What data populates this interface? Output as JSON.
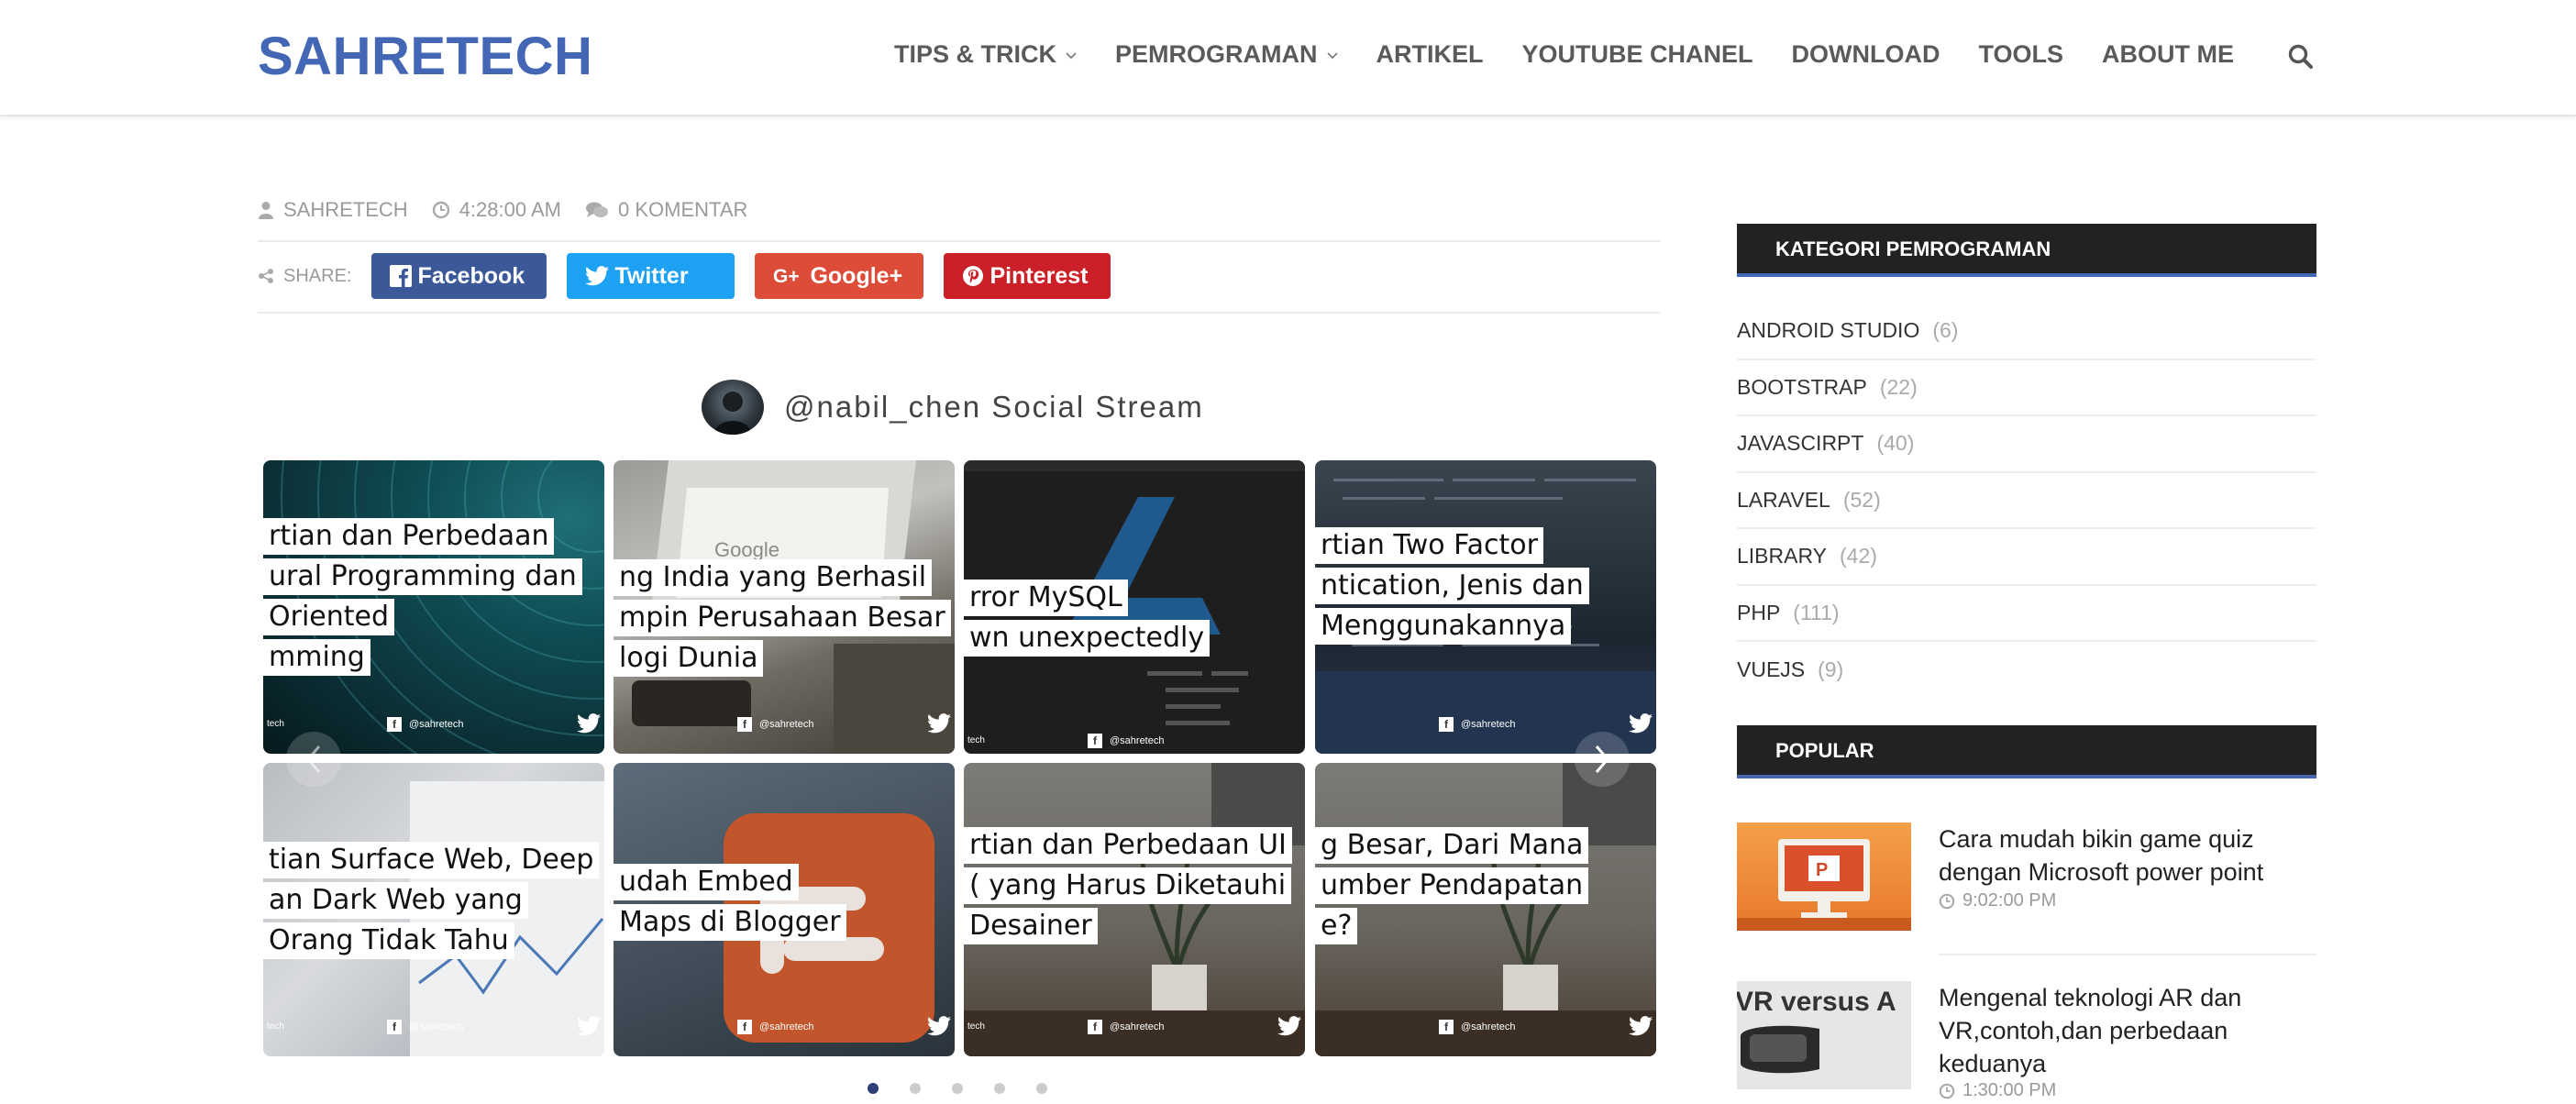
{
  "header": {
    "logo": "SAHRETECH",
    "nav": [
      {
        "label": "TIPS & TRICK",
        "has_dropdown": true
      },
      {
        "label": "PEMROGRAMAN",
        "has_dropdown": true
      },
      {
        "label": "ARTIKEL",
        "has_dropdown": false
      },
      {
        "label": "YOUTUBE CHANEL",
        "has_dropdown": false
      },
      {
        "label": "DOWNLOAD",
        "has_dropdown": false
      },
      {
        "label": "TOOLS",
        "has_dropdown": false
      },
      {
        "label": "ABOUT ME",
        "has_dropdown": false
      }
    ],
    "search_icon": "search-icon"
  },
  "post": {
    "author": "SAHRETECH",
    "time": "4:28:00 AM",
    "comments": "0 KOMENTAR",
    "share_label": "SHARE:",
    "share_buttons": {
      "facebook": "Facebook",
      "twitter": "Twitter",
      "googleplus": "Google+",
      "pinterest": "Pinterest"
    }
  },
  "stream": {
    "title": "@nabil_chen Social Stream",
    "tiles": [
      {
        "lines": [
          "rtian dan Perbedaan",
          "ural Programming dan",
          " Oriented",
          "mming"
        ],
        "footer": "@sahretech"
      },
      {
        "lines": [
          "ng India yang Berhasil",
          "mpin Perusahaan Besar",
          "logi Dunia"
        ],
        "footer": "@sahretech"
      },
      {
        "lines": [
          "rror MySQL",
          "wn unexpectedly"
        ],
        "footer": "@sahretech"
      },
      {
        "lines": [
          "rtian Two Factor",
          "ntication, Jenis dan",
          " Menggunakannya"
        ],
        "footer": "@sahretech"
      },
      {
        "lines": [
          "tian Surface Web, Deep",
          "an Dark Web yang",
          " Orang Tidak Tahu"
        ],
        "footer": "@sahretech"
      },
      {
        "lines": [
          "udah Embed",
          " Maps di Blogger"
        ],
        "footer": "@sahretech"
      },
      {
        "lines": [
          "rtian dan Perbedaan UI",
          "( yang Harus Diketauhi",
          "Desainer"
        ],
        "footer": "@sahretech"
      },
      {
        "lines": [
          "g Besar, Dari Mana",
          "umber Pendapatan",
          "e?"
        ],
        "footer": "@sahretech"
      }
    ],
    "tile_left_mark": "tech",
    "page_count": 5,
    "active_page": 1
  },
  "sidebar": {
    "categories_title": "KATEGORI PEMROGRAMAN",
    "categories": [
      {
        "name": "ANDROID STUDIO",
        "count": "(6)"
      },
      {
        "name": "BOOTSTRAP",
        "count": "(22)"
      },
      {
        "name": "JAVASCIRPT",
        "count": "(40)"
      },
      {
        "name": "LARAVEL",
        "count": "(52)"
      },
      {
        "name": "LIBRARY",
        "count": "(42)"
      },
      {
        "name": "PHP",
        "count": "(111)"
      },
      {
        "name": "VUEJS",
        "count": "(9)"
      }
    ],
    "popular_title": "POPULAR",
    "popular": [
      {
        "title": "Cara mudah bikin game quiz dengan Microsoft power point",
        "time": "9:02:00 PM"
      },
      {
        "title": "Mengenal teknologi AR dan VR,contoh,dan perbedaan keduanya",
        "time": "1:30:00 PM",
        "thumb_text": "VR versus A"
      }
    ]
  },
  "colors": {
    "brand": "#4367b5",
    "facebook": "#3b5998",
    "twitter": "#1da1f2",
    "googleplus": "#dd4b39",
    "pinterest": "#cb2027",
    "widget_bg": "#222222"
  }
}
